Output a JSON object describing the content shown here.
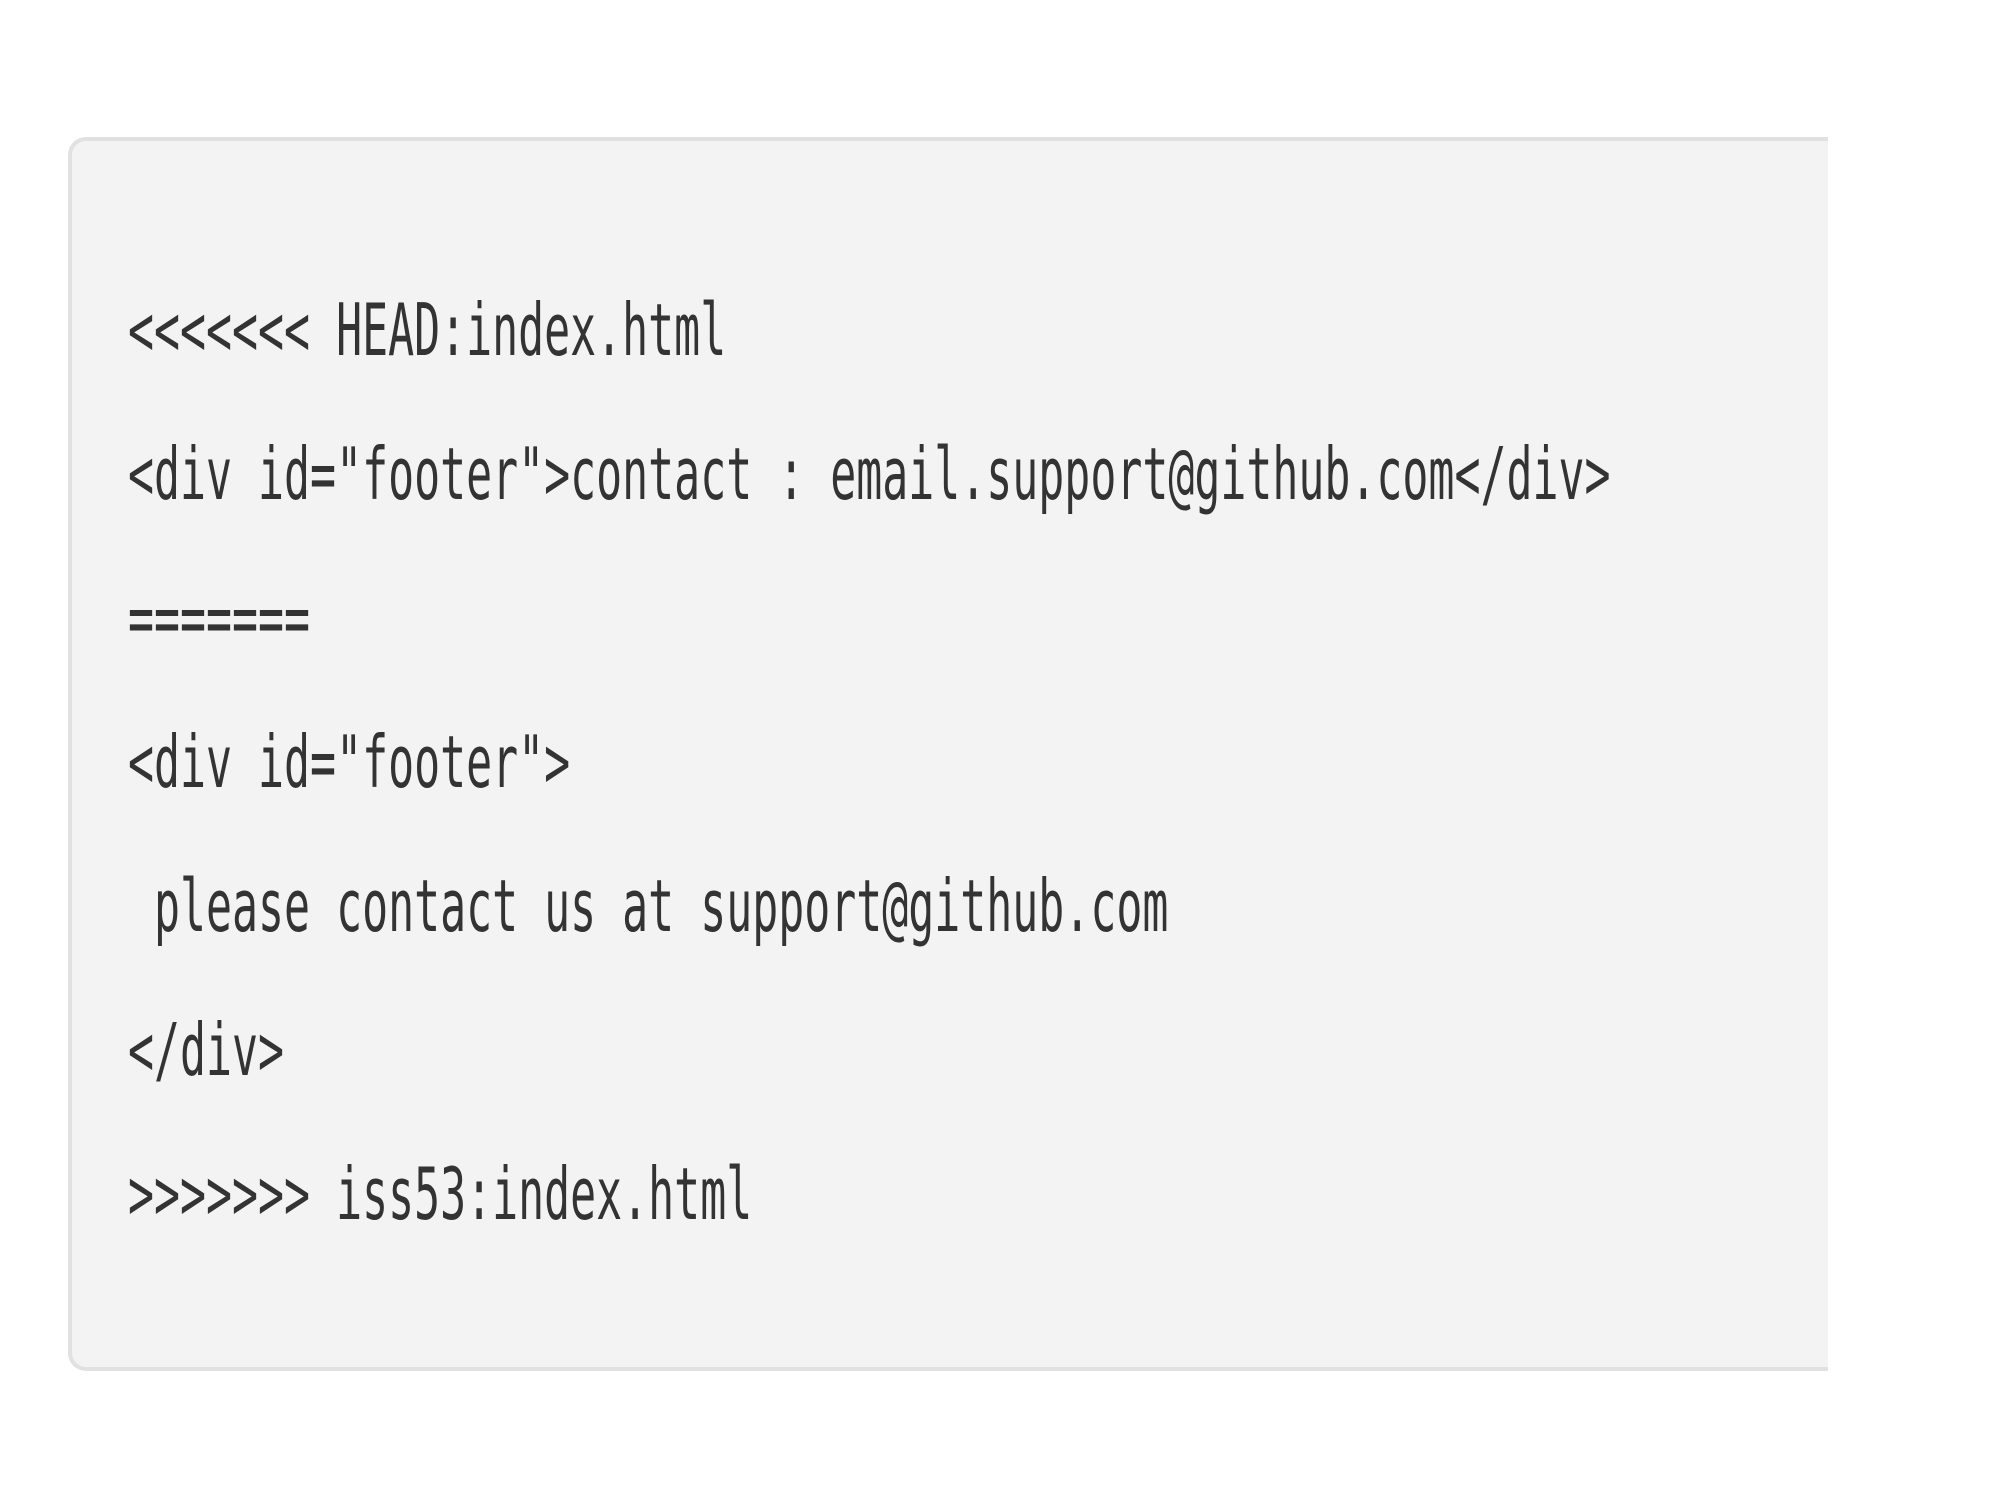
{
  "code": {
    "lines": [
      "<<<<<<< HEAD:index.html",
      "<div id=\"footer\">contact : email.support@github.com</div>",
      "=======",
      "<div id=\"footer\">",
      " please contact us at support@github.com",
      "</div>",
      ">>>>>>> iss53:index.html"
    ]
  },
  "colors": {
    "background": "#ffffff",
    "code_background": "#f3f3f3",
    "code_border": "#e1e1e1",
    "code_text": "#333333"
  }
}
